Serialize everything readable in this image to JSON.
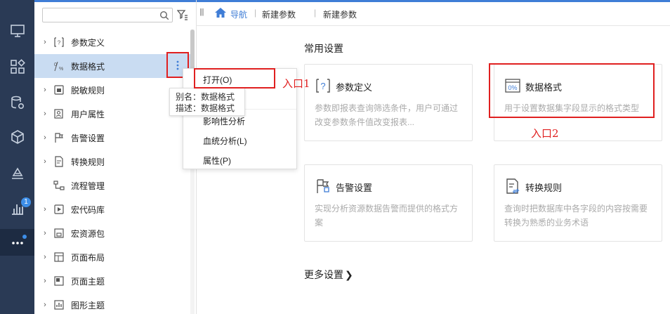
{
  "rail": {
    "badge_count": "1"
  },
  "tree": {
    "search_placeholder": "",
    "items": [
      {
        "label": "参数定义",
        "icon": "parameter-icon",
        "expandable": true
      },
      {
        "label": "数据格式",
        "icon": "data-format-icon",
        "expandable": false
      },
      {
        "label": "脱敏规则",
        "icon": "mask-rule-icon",
        "expandable": true
      },
      {
        "label": "用户属性",
        "icon": "user-attribute-icon",
        "expandable": true
      },
      {
        "label": "告警设置",
        "icon": "alert-flag-icon",
        "expandable": true
      },
      {
        "label": "转换规则",
        "icon": "convert-rule-icon",
        "expandable": true
      },
      {
        "label": "流程管理",
        "icon": "workflow-icon",
        "expandable": false
      },
      {
        "label": "宏代码库",
        "icon": "macro-library-icon",
        "expandable": true
      },
      {
        "label": "宏资源包",
        "icon": "macro-package-icon",
        "expandable": true
      },
      {
        "label": "页面布局",
        "icon": "page-layout-icon",
        "expandable": true
      },
      {
        "label": "页面主题",
        "icon": "page-theme-icon",
        "expandable": true
      },
      {
        "label": "图形主题",
        "icon": "chart-theme-icon",
        "expandable": true
      }
    ]
  },
  "tooltip": {
    "alias": "别名：数据格式",
    "desc": "描述：数据格式"
  },
  "context_menu": {
    "items": [
      "打开(O)",
      "影响性分析",
      "血统分析(L)",
      "属性(P)"
    ]
  },
  "annotations": {
    "entry1": "入口1",
    "entry2": "入口2"
  },
  "topbar": {
    "nav_label": "导航",
    "crumb1": "新建参数",
    "crumb2": "新建参数"
  },
  "main": {
    "section_title": "常用设置",
    "cards": [
      {
        "title": "参数定义",
        "desc": "参数即报表查询筛选条件，用户可通过改变参数条件值改变报表...",
        "icon": "parameter-icon"
      },
      {
        "title": "数据格式",
        "desc": "用于设置数据集字段显示的格式类型",
        "icon": "data-format-icon"
      },
      {
        "title": "告警设置",
        "desc": "实现分析资源数据告警而提供的格式方案",
        "icon": "alert-flag-icon"
      },
      {
        "title": "转换规则",
        "desc": "查询时把数据库中各字段的内容按需要转换为熟悉的业务术语",
        "icon": "convert-rule-icon"
      }
    ],
    "more_settings": "更多设置"
  },
  "colors": {
    "accent": "#3f7dd6",
    "rail_bg": "#2a3a55",
    "highlight_red": "#e02020",
    "selected_row": "#c9dcf2"
  }
}
